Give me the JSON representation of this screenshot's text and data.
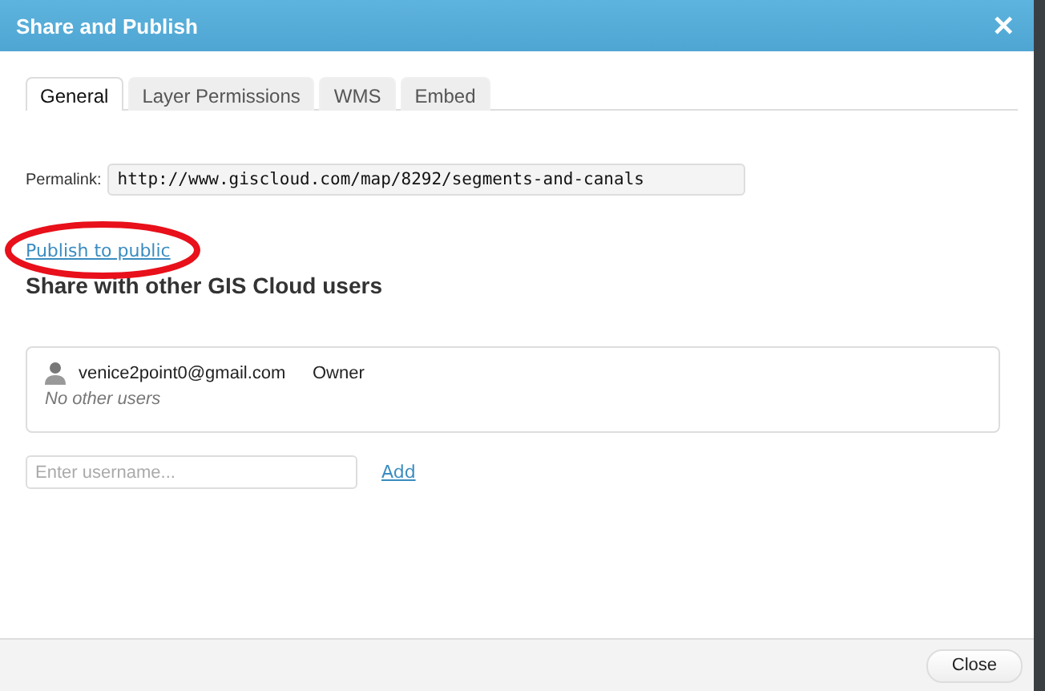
{
  "window": {
    "title": "Share and Publish",
    "close_glyph": "✕"
  },
  "tabs": [
    {
      "label": "General",
      "selected": true
    },
    {
      "label": "Layer Permissions",
      "selected": false
    },
    {
      "label": "WMS",
      "selected": false
    },
    {
      "label": "Embed",
      "selected": false
    }
  ],
  "permalink": {
    "label": "Permalink:",
    "value": "http://www.giscloud.com/map/8292/segments-and-canals"
  },
  "publish_link": {
    "label": "Publish to public",
    "highlighted": true
  },
  "share_heading": "Share with other GIS Cloud users",
  "users": [
    {
      "email": "venice2point0@gmail.com",
      "role": "Owner"
    }
  ],
  "users_note": "No other users",
  "username_field": {
    "placeholder": "Enter username..."
  },
  "add_link": "Add",
  "footer_button": "Close"
}
